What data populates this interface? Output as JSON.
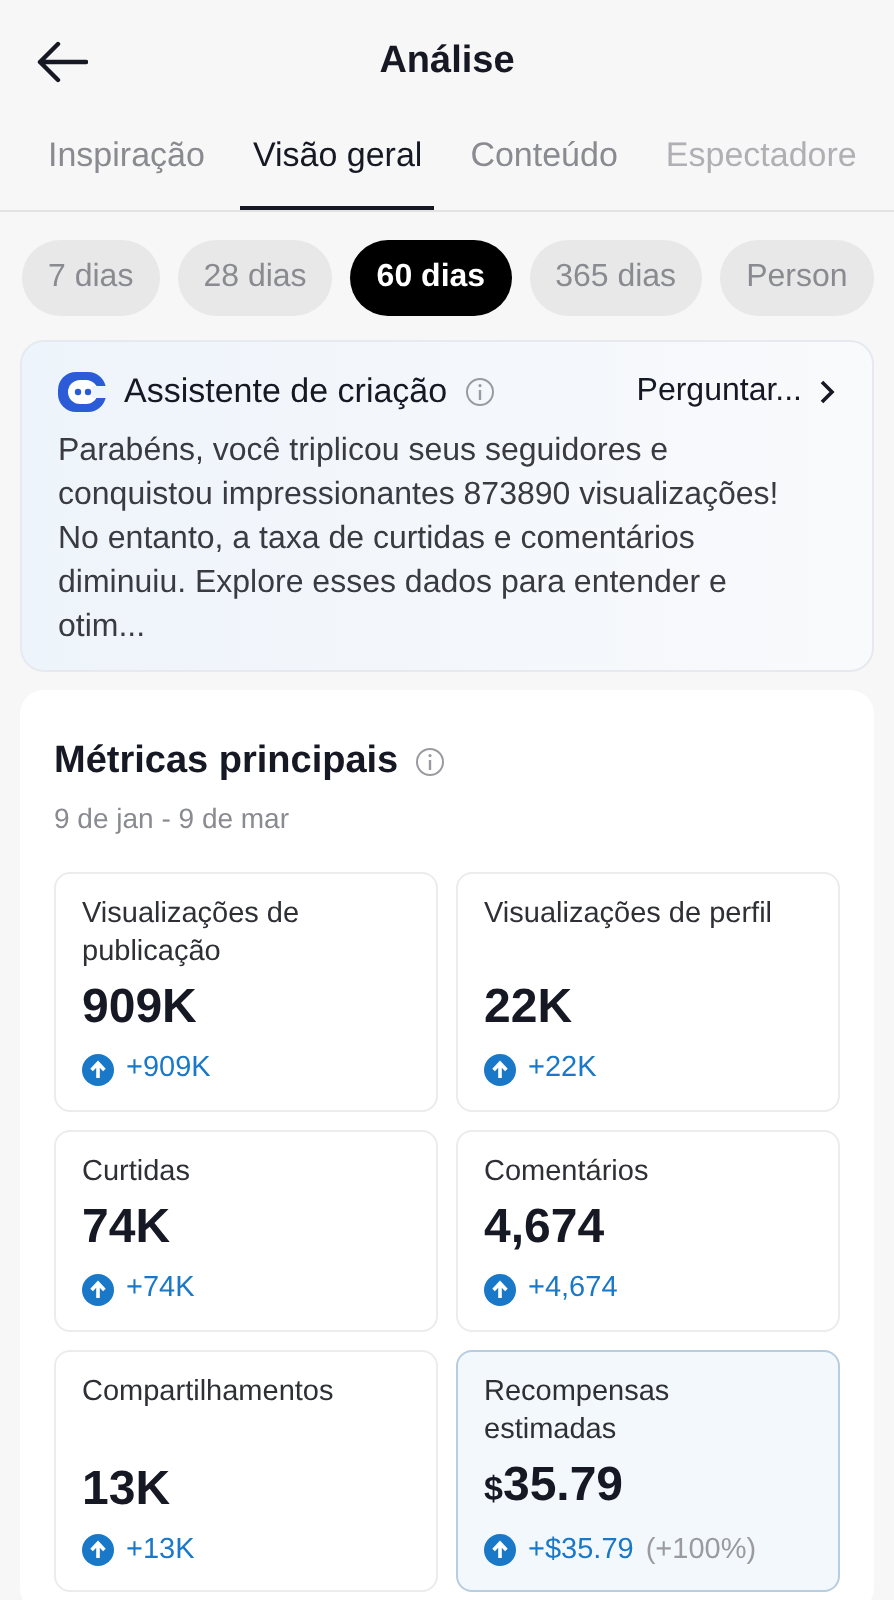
{
  "header": {
    "title": "Análise"
  },
  "tabs": [
    {
      "label": "Inspiração",
      "selected": false
    },
    {
      "label": "Visão geral",
      "selected": true
    },
    {
      "label": "Conteúdo",
      "selected": false
    },
    {
      "label": "Espectadore",
      "selected": false
    }
  ],
  "periods": [
    {
      "label": "7 dias",
      "selected": false
    },
    {
      "label": "28 dias",
      "selected": false
    },
    {
      "label": "60 dias",
      "selected": true
    },
    {
      "label": "365 dias",
      "selected": false
    },
    {
      "label": "Person",
      "selected": false
    }
  ],
  "assistant": {
    "title": "Assistente de criação",
    "action": "Perguntar...",
    "text": "Parabéns, você triplicou seus seguidores e conquistou impressionantes 873890 visualizações! No entanto, a taxa de curtidas e comentários diminuiu. Explore esses dados para entender e otim..."
  },
  "metrics_section": {
    "title": "Métricas principais",
    "date_range": "9 de jan - 9 de mar",
    "metrics": [
      {
        "label": "Visualizações de publicação",
        "value": "909K",
        "delta": "+909K",
        "highlighted": false
      },
      {
        "label": "Visualizações de perfil",
        "value": "22K",
        "delta": "+22K",
        "highlighted": false
      },
      {
        "label": "Curtidas",
        "value": "74K",
        "delta": "+74K",
        "highlighted": false
      },
      {
        "label": "Comentários",
        "value": "4,674",
        "delta": "+4,674",
        "highlighted": false
      },
      {
        "label": "Compartilhamentos",
        "value": "13K",
        "delta": "+13K",
        "highlighted": false
      },
      {
        "label": "Recompensas estimadas",
        "currency": "$",
        "value": "35.79",
        "delta": "+$35.79",
        "delta_note": "(+100%)",
        "highlighted": true
      }
    ]
  }
}
